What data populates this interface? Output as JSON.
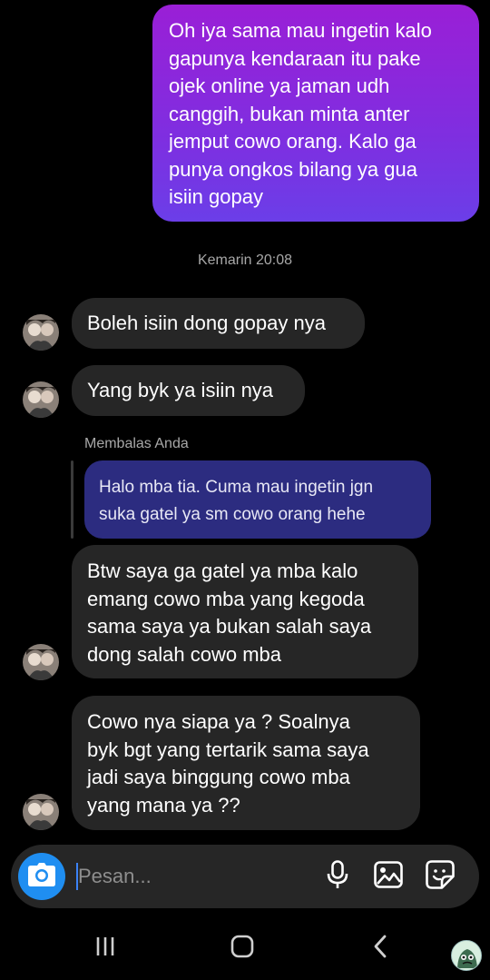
{
  "messages": {
    "outgoing_1": "Oh iya sama mau ingetin kalo\ngapunya kendaraan itu pake\nojek online ya jaman udh\ncanggih, bukan minta anter\njemput cowo orang. Kalo ga\npunya ongkos bilang ya gua\nisiin gopay",
    "timestamp": "Kemarin 20:08",
    "incoming_1": "Boleh isiin dong gopay nya",
    "incoming_2": "Yang byk ya isiin nya",
    "reply_label": "Membalas Anda",
    "reply_quote": "Halo mba tia. Cuma mau ingetin jgn\nsuka gatel ya sm cowo orang hehe",
    "incoming_3": "Btw saya ga gatel ya mba kalo\nemang cowo mba yang kegoda\nsama saya ya bukan salah saya\ndong salah cowo mba",
    "incoming_4": "Cowo nya siapa ya ? Soalnya\nbyk bgt yang tertarik sama saya\njadi saya binggung cowo mba\nyang mana ya ??"
  },
  "composer": {
    "placeholder": "Pesan...",
    "value": "",
    "icons": [
      "camera-icon",
      "microphone-icon",
      "gallery-icon",
      "sticker-icon"
    ]
  },
  "navbar": {
    "icons": [
      "recent-apps-icon",
      "home-icon",
      "back-icon",
      "floating-avatar"
    ]
  },
  "colors": {
    "background": "#000000",
    "incoming_bubble": "#262626",
    "outgoing_gradient_start": "#9a1fd6",
    "outgoing_gradient_end": "#6b3ee8",
    "reply_quote": "#2c2c80",
    "camera_button": "#1f8ef1"
  }
}
